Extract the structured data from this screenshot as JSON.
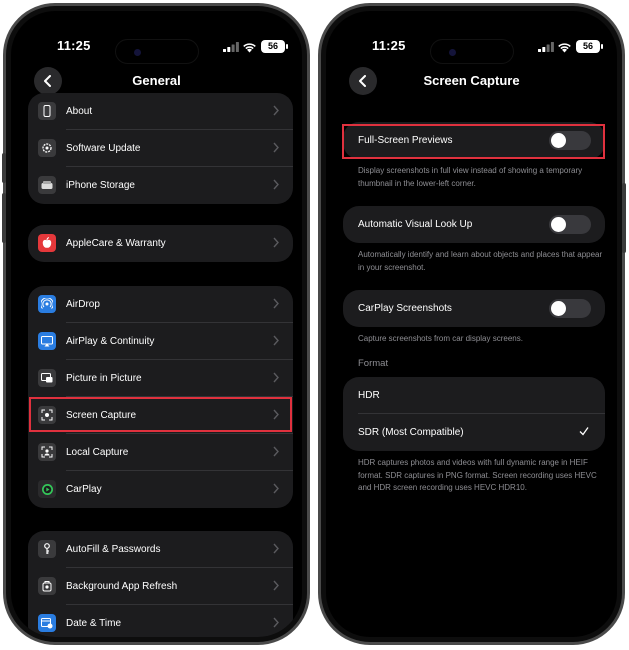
{
  "colors": {
    "highlight": "#e0313e",
    "toggle_off": "#39393d",
    "cell_bg": "#1c1c1e",
    "secondary_text": "#8e8e93"
  },
  "left_phone": {
    "status": {
      "time": "11:25",
      "battery": "56"
    },
    "nav": {
      "back_icon": "chevron-left-icon",
      "title": "General"
    },
    "groups": [
      {
        "items": [
          {
            "label": "About",
            "icon": "phone-outline-icon"
          },
          {
            "label": "Software Update",
            "icon": "gear-update-icon"
          },
          {
            "label": "iPhone Storage",
            "icon": "storage-drive-icon"
          }
        ]
      },
      {
        "items": [
          {
            "label": "AppleCare & Warranty",
            "icon": "apple-logo-icon"
          }
        ]
      },
      {
        "items": [
          {
            "label": "AirDrop",
            "icon": "airdrop-icon"
          },
          {
            "label": "AirPlay & Continuity",
            "icon": "airplay-icon"
          },
          {
            "label": "Picture in Picture",
            "icon": "pip-icon"
          },
          {
            "label": "Screen Capture",
            "icon": "camera-screenshot-icon",
            "highlighted": true
          },
          {
            "label": "Local Capture",
            "icon": "local-capture-icon"
          },
          {
            "label": "CarPlay",
            "icon": "carplay-icon"
          }
        ]
      },
      {
        "items": [
          {
            "label": "AutoFill & Passwords",
            "icon": "key-icon"
          },
          {
            "label": "Background App Refresh",
            "icon": "refresh-gear-icon"
          },
          {
            "label": "Date & Time",
            "icon": "calendar-clock-icon"
          }
        ]
      }
    ]
  },
  "right_phone": {
    "status": {
      "time": "11:25",
      "battery": "56"
    },
    "nav": {
      "back_icon": "chevron-left-icon",
      "title": "Screen Capture"
    },
    "full_screen_previews": {
      "label": "Full-Screen Previews",
      "enabled": false,
      "description": "Display screenshots in full view instead of showing a temporary thumbnail in the lower-left corner."
    },
    "visual_look_up": {
      "label": "Automatic Visual Look Up",
      "enabled": false,
      "description": "Automatically identify and learn about objects and places that appear in your screenshot."
    },
    "carplay_screenshots": {
      "label": "CarPlay Screenshots",
      "enabled": false,
      "description": "Capture screenshots from car display screens."
    },
    "format": {
      "header": "Format",
      "options": [
        {
          "label": "HDR",
          "selected": false
        },
        {
          "label": "SDR (Most Compatible)",
          "selected": true
        }
      ],
      "description": "HDR captures photos and videos with full dynamic range in HEIF format. SDR captures in PNG format. Screen recording uses HEVC and HDR screen recording uses HEVC HDR10."
    }
  }
}
